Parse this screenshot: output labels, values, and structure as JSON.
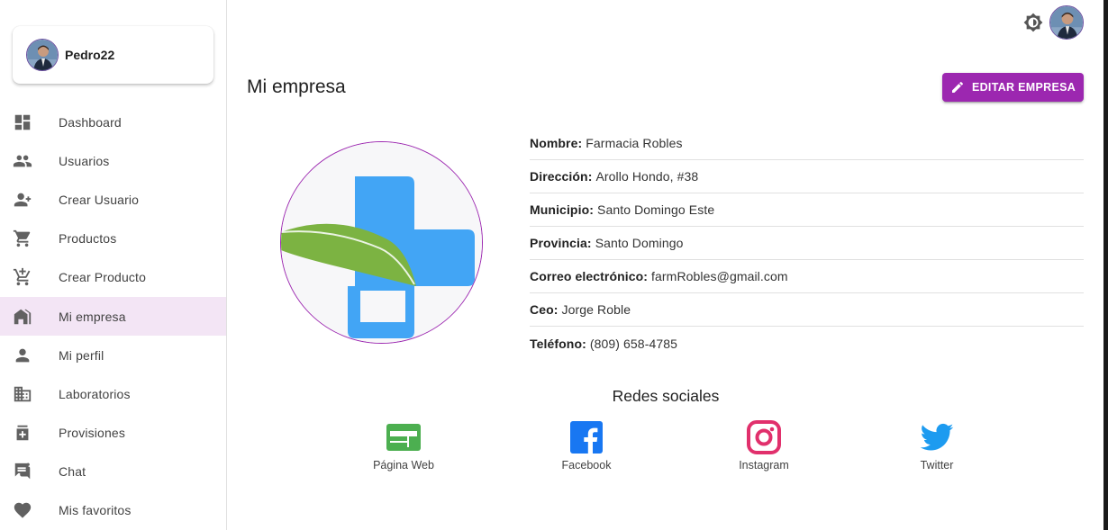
{
  "user": {
    "name": "Pedro22"
  },
  "nav": {
    "items": [
      {
        "label": "Dashboard",
        "icon": "dashboard-icon"
      },
      {
        "label": "Usuarios",
        "icon": "people-icon"
      },
      {
        "label": "Crear Usuario",
        "icon": "person-add-icon"
      },
      {
        "label": "Productos",
        "icon": "cart-icon"
      },
      {
        "label": "Crear Producto",
        "icon": "add-cart-icon"
      },
      {
        "label": "Mi empresa",
        "icon": "store-icon",
        "active": true
      },
      {
        "label": "Mi perfil",
        "icon": "person-icon"
      },
      {
        "label": "Laboratorios",
        "icon": "business-icon"
      },
      {
        "label": "Provisiones",
        "icon": "medication-icon"
      },
      {
        "label": "Chat",
        "icon": "chat-icon"
      },
      {
        "label": "Mis favoritos",
        "icon": "heart-icon"
      }
    ]
  },
  "main": {
    "title": "Mi empresa",
    "edit_button_label": "EDITAR EMPRESA",
    "info": [
      {
        "label": "Nombre:",
        "value": "Farmacia Robles"
      },
      {
        "label": "Dirección:",
        "value": "Arollo Hondo, #38"
      },
      {
        "label": "Municipio:",
        "value": "Santo Domingo Este"
      },
      {
        "label": "Provincia:",
        "value": "Santo Domingo"
      },
      {
        "label": "Correo electrónico:",
        "value": "farmRobles@gmail.com"
      },
      {
        "label": "Ceo:",
        "value": "Jorge Roble"
      },
      {
        "label": "Teléfono:",
        "value": "(809) 658-4785"
      }
    ],
    "social_title": "Redes sociales",
    "social": [
      {
        "label": "Página Web",
        "icon": "web-icon",
        "color": "#4caf50"
      },
      {
        "label": "Facebook",
        "icon": "facebook-icon",
        "color": "#1877f2"
      },
      {
        "label": "Instagram",
        "icon": "instagram-icon",
        "color": "#e1306c"
      },
      {
        "label": "Twitter",
        "icon": "twitter-icon",
        "color": "#1d9bf0"
      }
    ]
  },
  "colors": {
    "accent": "#9c27b0",
    "active_bg": "#f3e5f5",
    "logo_blue": "#42a5f5",
    "logo_green": "#7cb342"
  }
}
